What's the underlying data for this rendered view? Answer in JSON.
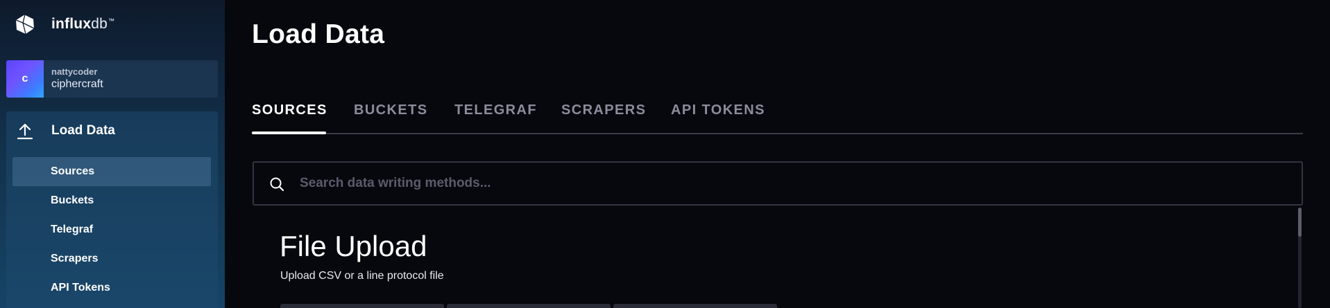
{
  "brand": {
    "name_bold": "influx",
    "name_light": "db",
    "trademark": "™",
    "logo_icon": "influxdb-cube-icon"
  },
  "org": {
    "avatar_letter": "c",
    "user": "nattycoder",
    "name": "ciphercraft"
  },
  "nav": {
    "section_label": "Load Data",
    "section_icon": "upload-icon",
    "items": [
      {
        "label": "Sources",
        "active": true
      },
      {
        "label": "Buckets",
        "active": false
      },
      {
        "label": "Telegraf",
        "active": false
      },
      {
        "label": "Scrapers",
        "active": false
      },
      {
        "label": "API Tokens",
        "active": false
      }
    ]
  },
  "main": {
    "title": "Load Data",
    "tabs": [
      {
        "label": "SOURCES",
        "active": true
      },
      {
        "label": "BUCKETS",
        "active": false
      },
      {
        "label": "TELEGRAF",
        "active": false
      },
      {
        "label": "SCRAPERS",
        "active": false
      },
      {
        "label": "API TOKENS",
        "active": false
      }
    ],
    "search": {
      "placeholder": "Search data writing methods...",
      "value": ""
    },
    "section": {
      "title": "File Upload",
      "subtitle": "Upload CSV or a line protocol file"
    }
  },
  "colors": {
    "background": "#07080d",
    "sidebar_top": "#0e1a2c",
    "sidebar_bottom": "#164466",
    "avatar_start": "#5a44ff",
    "avatar_end": "#31a7ff",
    "tab_inactive": "#8b8d9c",
    "tab_active": "#ffffff"
  }
}
